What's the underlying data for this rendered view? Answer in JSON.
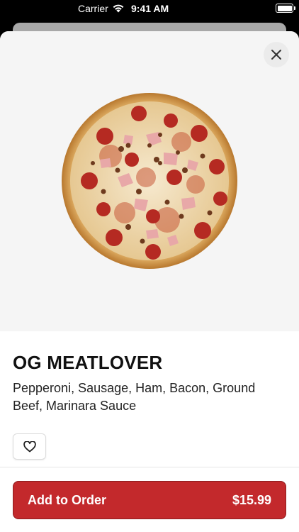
{
  "status_bar": {
    "carrier": "Carrier",
    "time": "9:41 AM"
  },
  "product": {
    "name": "OG MEATLOVER",
    "description": "Pepperoni, Sausage, Ham, Bacon, Ground Beef, Marinara Sauce",
    "price": "$15.99",
    "image_icon": "pizza-image"
  },
  "actions": {
    "add_label": "Add to Order",
    "close_icon": "close-icon",
    "favorite_icon": "heart-icon"
  },
  "colors": {
    "accent": "#c3292c",
    "hero_bg": "#f5f5f5"
  }
}
